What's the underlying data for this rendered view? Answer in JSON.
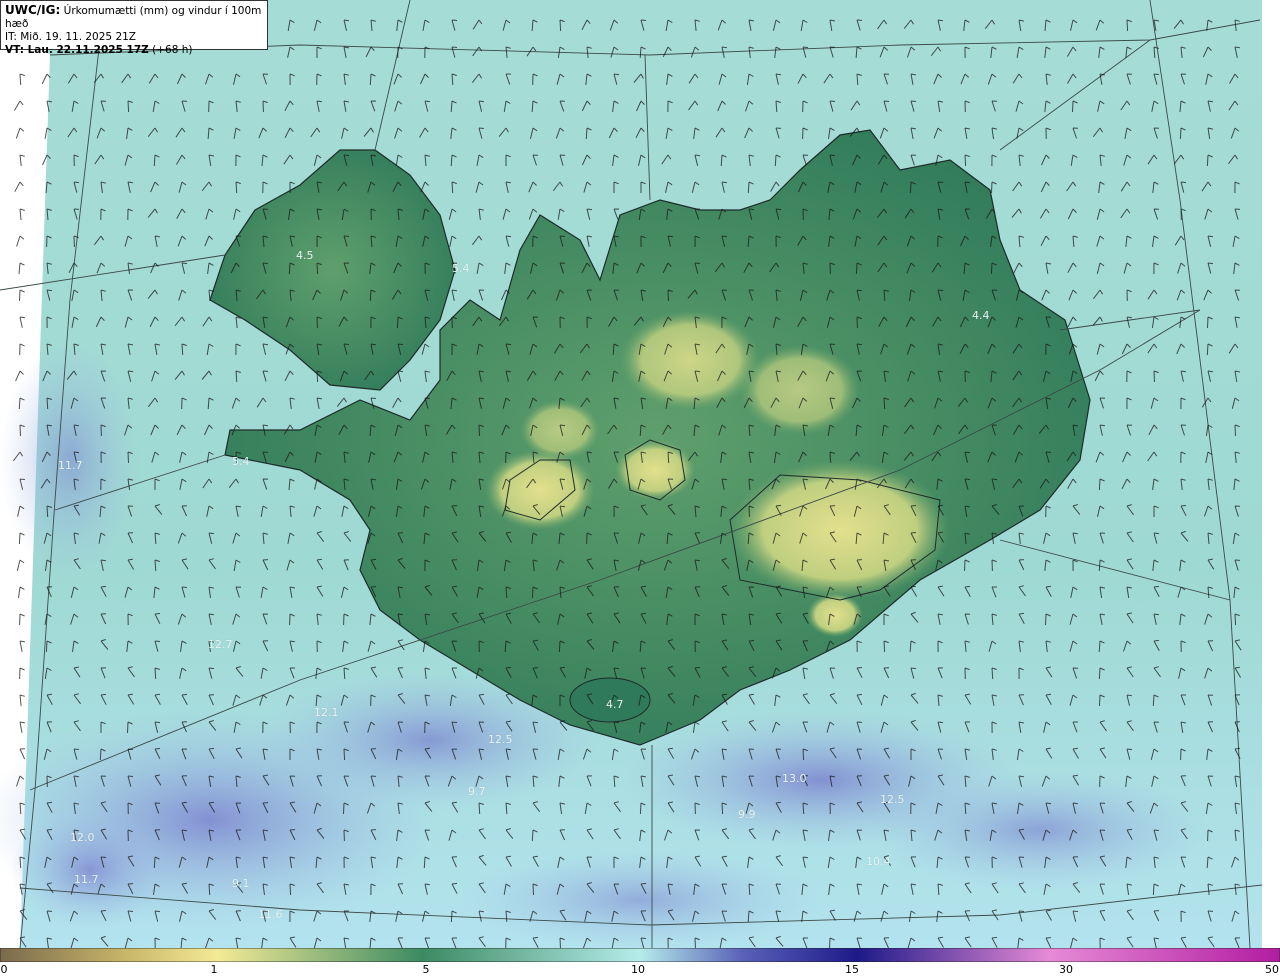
{
  "header": {
    "model": "UWC/IG:",
    "description": " Úrkomumætti (mm) og vindur í 100m hæð",
    "init_time": "IT: Mið. 19. 11. 2025 21Z",
    "valid_label": "VT:",
    "valid_time": " Lau. 22.11.2025 17Z",
    "lead": " (+68 h)"
  },
  "map_labels": [
    {
      "text": "4.5"
    },
    {
      "text": "5.4"
    },
    {
      "text": "5.4"
    },
    {
      "text": "4.4"
    },
    {
      "text": "4.7"
    },
    {
      "text": "11.7"
    },
    {
      "text": "12.7"
    },
    {
      "text": "12.1"
    },
    {
      "text": "12.5"
    },
    {
      "text": "9.7"
    },
    {
      "text": "13.0"
    },
    {
      "text": "12.5"
    },
    {
      "text": "9.9"
    },
    {
      "text": "10.4"
    },
    {
      "text": "9.1"
    },
    {
      "text": "11.6"
    },
    {
      "text": "11.7"
    },
    {
      "text": "12.0"
    }
  ],
  "colorbar": {
    "ticks": [
      {
        "label": "0",
        "value": 0
      },
      {
        "label": "1",
        "value": 1
      },
      {
        "label": "5",
        "value": 5
      },
      {
        "label": "10",
        "value": 10
      },
      {
        "label": "15",
        "value": 15
      },
      {
        "label": "30",
        "value": 30
      },
      {
        "label": "50",
        "value": 50
      }
    ],
    "colors": [
      "#7a6a4c",
      "#c9b76a",
      "#f3ea96",
      "#3c8a62",
      "#b5ecea",
      "#5a61b8",
      "#1d1a88",
      "#e68ad6",
      "#b11da1"
    ]
  },
  "colors": {
    "ocean": "#9fdad4",
    "land_low": "#2f7a5a",
    "land_high": "#d7d883",
    "heavy": "#8e9ad8"
  }
}
